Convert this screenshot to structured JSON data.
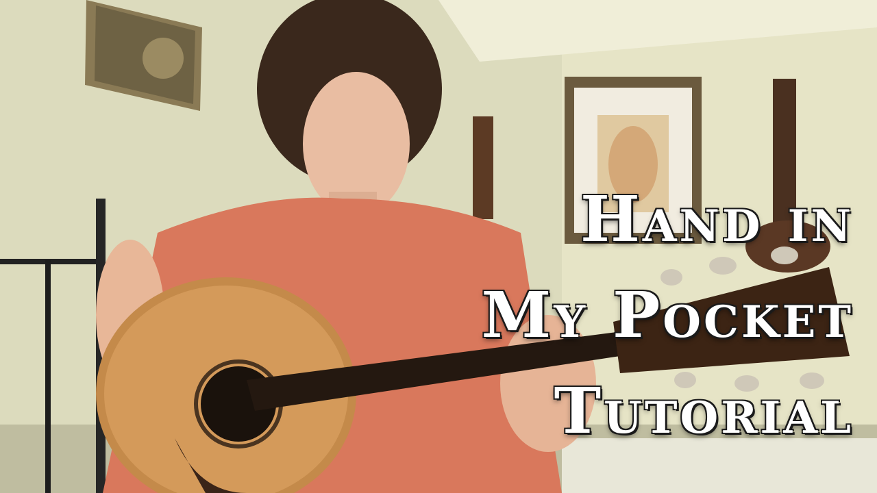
{
  "thumbnail": {
    "title_lines": [
      "Hand in",
      "My Pocket",
      "Tutorial"
    ],
    "colors": {
      "wall": "#d9d8b8",
      "shirt": "#d9785c",
      "guitar_top": "#c48a4a",
      "text": "#ffffff"
    }
  }
}
